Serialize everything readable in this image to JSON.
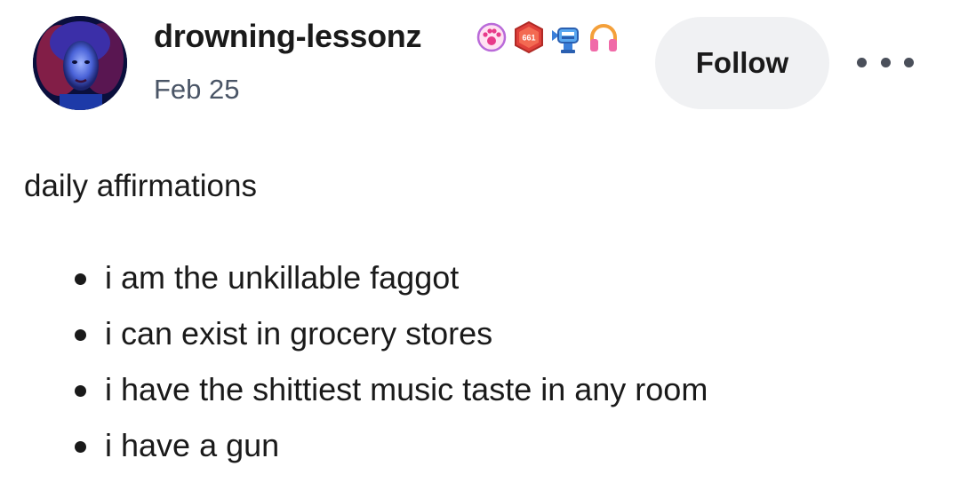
{
  "post": {
    "username": "drowning-lessonz",
    "date": "Feb 25",
    "follow_label": "Follow",
    "badges": [
      "paw-badge-icon",
      "hexagon-661-badge-icon",
      "robot-fish-badge-icon",
      "headphones-badge-icon"
    ],
    "badge_text": "661",
    "title": "daily affirmations",
    "items": [
      "i am the unkillable faggot",
      "i can exist in grocery stores",
      "i have the shittiest music taste in any room",
      "i have a gun"
    ]
  },
  "colors": {
    "follow_bg": "#f0f1f3",
    "date_text": "#4a5566",
    "text": "#1a1a1a"
  }
}
